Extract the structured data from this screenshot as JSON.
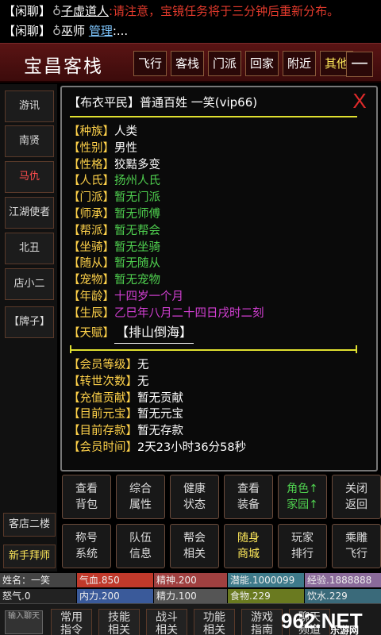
{
  "chat": {
    "line1": {
      "tag": "【闲聊】",
      "sym": "♁",
      "name": "子虚道人",
      "sep": ":",
      "msg": "请注意，宝镜任务将于三分钟后重新分布。"
    },
    "line2": {
      "tag": "【闲聊】",
      "sym": "♁",
      "name": "巫师",
      "link": "管理",
      "msg": ":..."
    }
  },
  "header": {
    "title": "宝昌客栈",
    "nav": [
      "飞行",
      "客栈",
      "门派",
      "回家",
      "附近",
      "其他"
    ],
    "minus": "—"
  },
  "sidebar": [
    "游讯",
    "南贤",
    "马仇",
    "江湖使者",
    "北丑",
    "店小二",
    "【牌子】"
  ],
  "left_bottom": [
    "客店二楼",
    "新手拜师"
  ],
  "panel": {
    "heading": "【布衣平民】普通百姓 一笑(vip66)",
    "close": "X",
    "attrs": [
      {
        "k": "【种族】",
        "v": "人类",
        "c": "w"
      },
      {
        "k": "【性别】",
        "v": "男性",
        "c": "w"
      },
      {
        "k": "【性格】",
        "v": "狡黠多变",
        "c": "w"
      },
      {
        "k": "【人氏】",
        "v": "扬州人氏",
        "c": "g"
      },
      {
        "k": "【门派】",
        "v": "暂无门派",
        "c": "g"
      },
      {
        "k": "【师承】",
        "v": "暂无师傅",
        "c": "g"
      },
      {
        "k": "【帮派】",
        "v": "暂无帮会",
        "c": "g"
      },
      {
        "k": "【坐骑】",
        "v": "暂无坐骑",
        "c": "g"
      },
      {
        "k": "【随从】",
        "v": "暂无随从",
        "c": "g"
      },
      {
        "k": "【宠物】",
        "v": "暂无宠物",
        "c": "g"
      },
      {
        "k": "【年龄】",
        "v": "十四岁一个月",
        "c": "p"
      },
      {
        "k": "【生辰】",
        "v": "乙巳年八月二十四日戌时二刻",
        "c": "p"
      }
    ],
    "talent_key": "【天赋】",
    "talent_value": "【排山倒海】",
    "attrs2": [
      {
        "k": "【会员等级】",
        "v": "无"
      },
      {
        "k": "【转世次数】",
        "v": "无"
      },
      {
        "k": "【充值贡献】",
        "v": "暂无贡献"
      },
      {
        "k": "【目前元宝】",
        "v": "暂无元宝"
      },
      {
        "k": "【目前存款】",
        "v": "暂无存款"
      },
      {
        "k": "【会员时间】",
        "v": "2天23小时36分58秒"
      }
    ]
  },
  "grid": [
    {
      "l1": "查看",
      "l2": "背包",
      "c": ""
    },
    {
      "l1": "综合",
      "l2": "属性",
      "c": ""
    },
    {
      "l1": "健康",
      "l2": "状态",
      "c": ""
    },
    {
      "l1": "查看",
      "l2": "装备",
      "c": ""
    },
    {
      "l1": "角色↑",
      "l2": "家园↑",
      "c": "green"
    },
    {
      "l1": "关闭",
      "l2": "返回",
      "c": ""
    },
    {
      "l1": "称号",
      "l2": "系统",
      "c": ""
    },
    {
      "l1": "队伍",
      "l2": "信息",
      "c": ""
    },
    {
      "l1": "帮会",
      "l2": "相关",
      "c": ""
    },
    {
      "l1": "随身",
      "l2": "商城",
      "c": "yellow"
    },
    {
      "l1": "玩家",
      "l2": "排行",
      "c": ""
    },
    {
      "l1": "乘雕",
      "l2": "飞行",
      "c": ""
    }
  ],
  "status": {
    "name": "姓名：一笑",
    "hp": "气血.850",
    "jing": "精神.200",
    "qianneng": "潜能.1000099",
    "exp": "经验.1888888",
    "nuqi": "怒气.0",
    "neili": "内力.200",
    "jingli": "精力.100",
    "food": "食物.229",
    "water": "饮水.229"
  },
  "colors": {
    "hp": "#c0392b",
    "jing": "#b45a5a",
    "qianneng": "#3e7a8a",
    "exp": "#8a6a9a",
    "neili": "#3a5a9a",
    "jingli": "#555555",
    "food": "#6a7a20",
    "water": "#3a6a7a",
    "name": "#444444",
    "nuqi": "#2a2a2a"
  },
  "bottom": {
    "input": "输入聊天",
    "buttons": [
      {
        "l1": "常用",
        "l2": "指令"
      },
      {
        "l1": "技能",
        "l2": "相关"
      },
      {
        "l1": "战斗",
        "l2": "相关"
      },
      {
        "l1": "功能",
        "l2": "相关"
      },
      {
        "l1": "游戏",
        "l2": "指南"
      },
      {
        "l1": "聊天",
        "l2": "频道"
      }
    ],
    "watermark_logo": "962.NET",
    "watermark_sub": "乐游网"
  }
}
